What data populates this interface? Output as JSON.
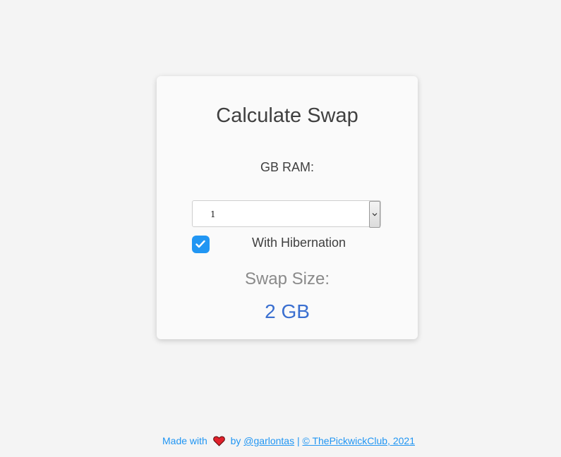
{
  "card": {
    "title": "Calculate Swap",
    "ram_label": "GB RAM:",
    "ram_select": {
      "value": "1"
    },
    "hibernation": {
      "label": "With Hibernation",
      "checked": true
    },
    "swap_label": "Swap Size:",
    "swap_value": "2 GB"
  },
  "footer": {
    "made_with": "Made with",
    "heart_icon": "heart-icon",
    "by": "by",
    "author_link": "@garlontas",
    "separator": "|",
    "copyright_link": "© ThePickwickClub, 2021"
  },
  "colors": {
    "accent": "#2196f3",
    "result": "#3a6fd0",
    "heart": "#e0202a"
  }
}
